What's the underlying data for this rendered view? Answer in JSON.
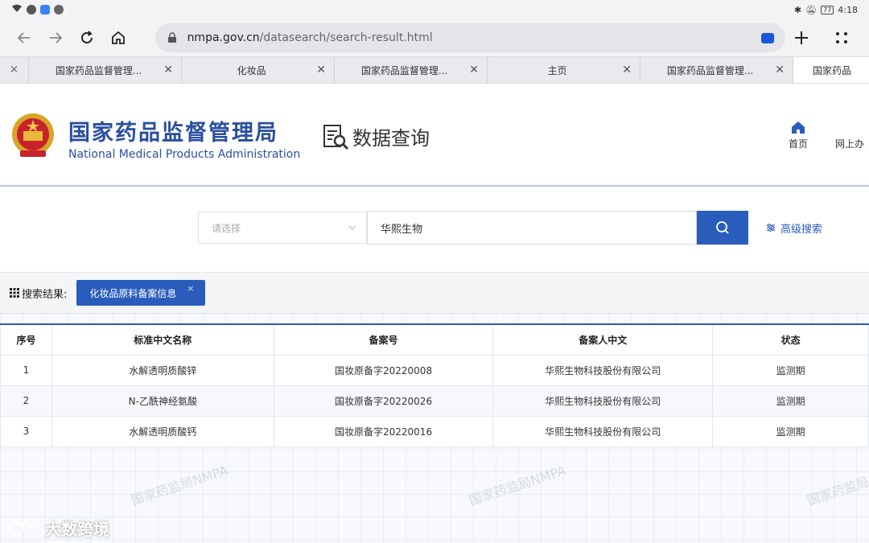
{
  "status_bar": {
    "time": "4:18",
    "battery": "77"
  },
  "browser": {
    "url_host": "nmpa.gov.cn",
    "url_path": "/datasearch/search-result.html",
    "tabs": [
      {
        "label": "国家药品监督管理..."
      },
      {
        "label": "化妆品"
      },
      {
        "label": "国家药品监督管理..."
      },
      {
        "label": "主页"
      },
      {
        "label": "国家药品监督管理..."
      },
      {
        "label": "国家药品"
      }
    ]
  },
  "header": {
    "brand_cn": "国家药品监督管理局",
    "brand_en": "National Medical Products Administration",
    "section_title": "数据查询",
    "nav": [
      {
        "label": "首页"
      },
      {
        "label": "网上办"
      }
    ]
  },
  "search": {
    "select_placeholder": "请选择",
    "query": "华熙生物",
    "advanced_label": "高级搜索"
  },
  "results": {
    "label": "搜索结果:",
    "filter_chip": "化妆品原料备案信息",
    "filter_chip_close": "×",
    "columns": [
      "序号",
      "标准中文名称",
      "备案号",
      "备案人中文",
      "状态"
    ],
    "rows": [
      [
        "1",
        "水解透明质酸锌",
        "国妆原备字20220008",
        "华熙生物科技股份有限公司",
        "监测期"
      ],
      [
        "2",
        "N-乙酰神经氨酸",
        "国妆原备字20220026",
        "华熙生物科技股份有限公司",
        "监测期"
      ],
      [
        "3",
        "水解透明质酸钙",
        "国妆原备字20220016",
        "华熙生物科技股份有限公司",
        "监测期"
      ]
    ]
  },
  "watermark": "国家药监局NMPA",
  "app_watermark": "大数跨境",
  "colors": {
    "accent": "#2a5dbb",
    "brand": "#2a4f9e"
  }
}
